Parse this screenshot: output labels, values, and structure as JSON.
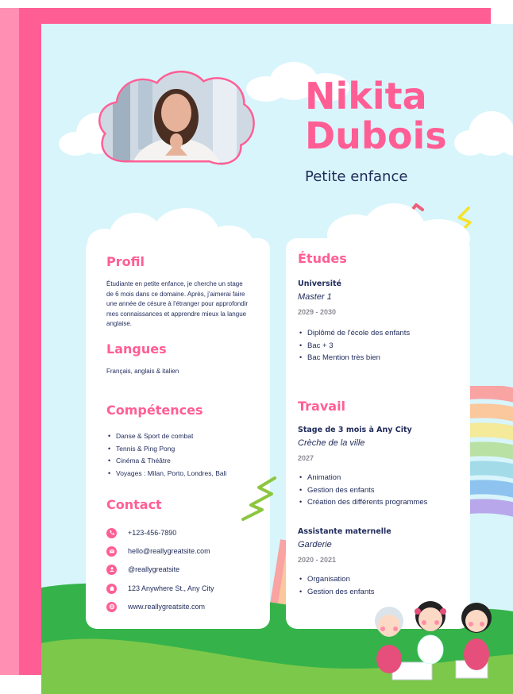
{
  "header": {
    "first_name": "Nikita",
    "last_name": "Dubois",
    "role": "Petite enfance"
  },
  "profile": {
    "title": "Profil",
    "text": "Étudiante en petite enfance, je cherche un stage de 6 mois dans ce domaine. Après, j'aimerai faire une année de césure à l'étranger pour approfondir mes connaissances et apprendre mieux la langue anglaise."
  },
  "languages": {
    "title": "Langues",
    "text": "Français, anglais & italien"
  },
  "skills": {
    "title": "Compétences",
    "items": [
      "Danse & Sport de combat",
      "Tennis & Ping Pong",
      "Cinéma & Théâtre",
      "Voyages : Milan, Porto, Londres, Bali"
    ]
  },
  "contact": {
    "title": "Contact",
    "items": [
      {
        "icon": "phone-icon",
        "text": "+123-456-7890"
      },
      {
        "icon": "mail-icon",
        "text": "hello@reallygreatsite.com"
      },
      {
        "icon": "user-icon",
        "text": "@reallygreatsite"
      },
      {
        "icon": "home-icon",
        "text": "123 Anywhere St., Any City"
      },
      {
        "icon": "globe-icon",
        "text": "www.reallygreatsite.com"
      }
    ]
  },
  "education": {
    "title": "Études",
    "school": "Université",
    "degree": "Master 1",
    "dates": "2029 - 2030",
    "items": [
      "Diplômé de l'école des enfants",
      "Bac + 3",
      "Bac Mention très bien"
    ]
  },
  "work": {
    "title": "Travail",
    "jobs": [
      {
        "title": "Stage de 3 mois à Any City",
        "place": "Crèche de la ville",
        "dates": "2027",
        "items": [
          "Animation",
          "Gestion des enfants",
          "Création des différents programmes"
        ]
      },
      {
        "title": "Assistante maternelle",
        "place": "Garderie",
        "dates": "2020 - 2021",
        "items": [
          "Organisation",
          "Gestion des enfants"
        ]
      }
    ]
  },
  "colors": {
    "pink": "#ff5e95",
    "light_pink": "#ff8fb3",
    "sky": "#d8f5fb",
    "navy": "#1f2a5a",
    "grass": "#35b34a"
  }
}
